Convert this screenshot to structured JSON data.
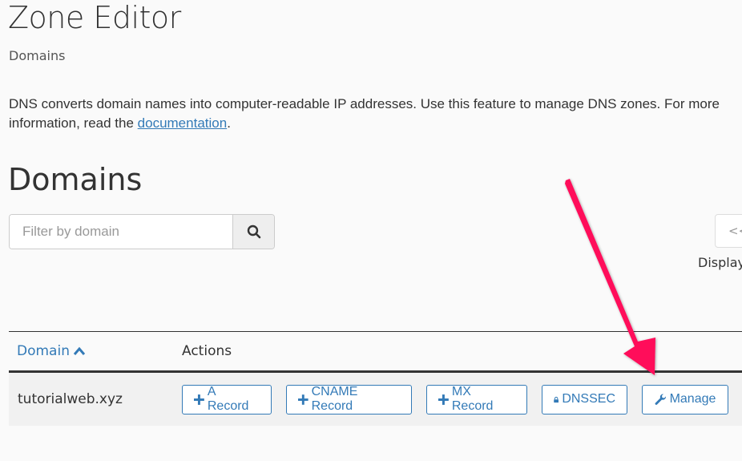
{
  "header": {
    "title": "Zone Editor",
    "subtitle": "Domains"
  },
  "description": {
    "text_before": "DNS converts domain names into computer-readable IP addresses. Use this feature to manage DNS zones. For more",
    "line2_before": "information, read the ",
    "link_label": "documentation",
    "after": "."
  },
  "domains_section": {
    "heading": "Domains",
    "search": {
      "placeholder": "Filter by domain",
      "value": "",
      "button_icon": "search-icon"
    },
    "pager": {
      "first_label": "<<",
      "displaying_text": "Displaying"
    }
  },
  "table": {
    "columns": [
      {
        "label": "Domain",
        "sort_icon": "chevron-up-icon"
      },
      {
        "label": "Actions"
      }
    ],
    "rows": [
      {
        "domain": "tutorialweb.xyz",
        "actions": [
          {
            "icon": "plus-icon",
            "label": "A Record"
          },
          {
            "icon": "plus-icon",
            "label": "CNAME Record"
          },
          {
            "icon": "plus-icon",
            "label": "MX Record"
          },
          {
            "icon": "lock-icon",
            "label": "DNSSEC"
          },
          {
            "icon": "wrench-icon",
            "label": "Manage"
          }
        ]
      }
    ]
  },
  "annotation": {
    "type": "arrow",
    "color": "#ff0a5a",
    "points_to": "Manage"
  }
}
